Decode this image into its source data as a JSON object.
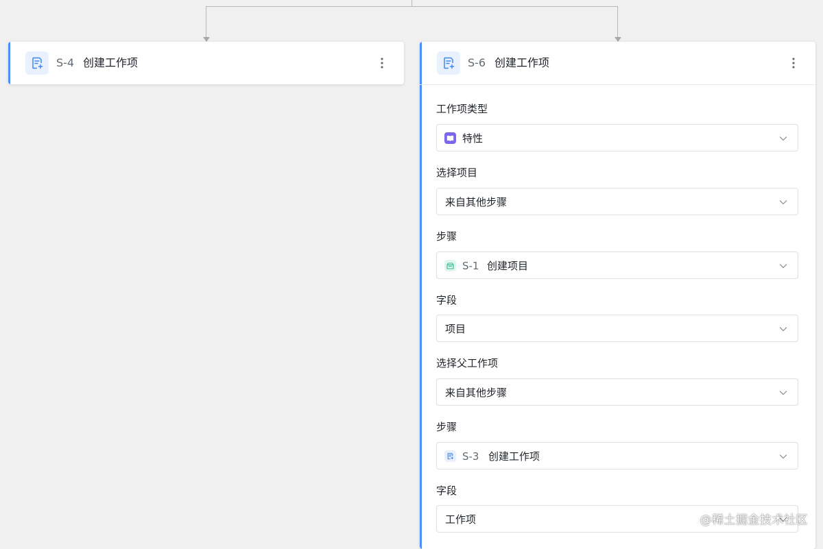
{
  "colors": {
    "accent": "#4a8ff7",
    "feature_icon": "#7b67ee",
    "project_icon": "#2bb98a"
  },
  "cards": {
    "s4": {
      "icon": "create-work-item-icon",
      "code": "S-4",
      "title": "创建工作项"
    },
    "s6": {
      "icon": "create-work-item-icon",
      "code": "S-6",
      "title": "创建工作项",
      "fields": {
        "work_item_type": {
          "label": "工作项类型",
          "value": "特性",
          "icon": "feature-book-icon"
        },
        "select_project": {
          "label": "选择项目",
          "value": "来自其他步骤"
        },
        "project_step": {
          "label": "步骤",
          "code": "S-1",
          "value": "创建项目",
          "icon": "project-icon"
        },
        "project_field": {
          "label": "字段",
          "value": "项目"
        },
        "select_parent": {
          "label": "选择父工作项",
          "value": "来自其他步骤"
        },
        "parent_step": {
          "label": "步骤",
          "code": "S-3",
          "value": "创建工作项",
          "icon": "create-work-item-icon"
        },
        "parent_field": {
          "label": "字段",
          "value": "工作项"
        }
      }
    }
  },
  "watermark": "@稀土掘金技术社区"
}
